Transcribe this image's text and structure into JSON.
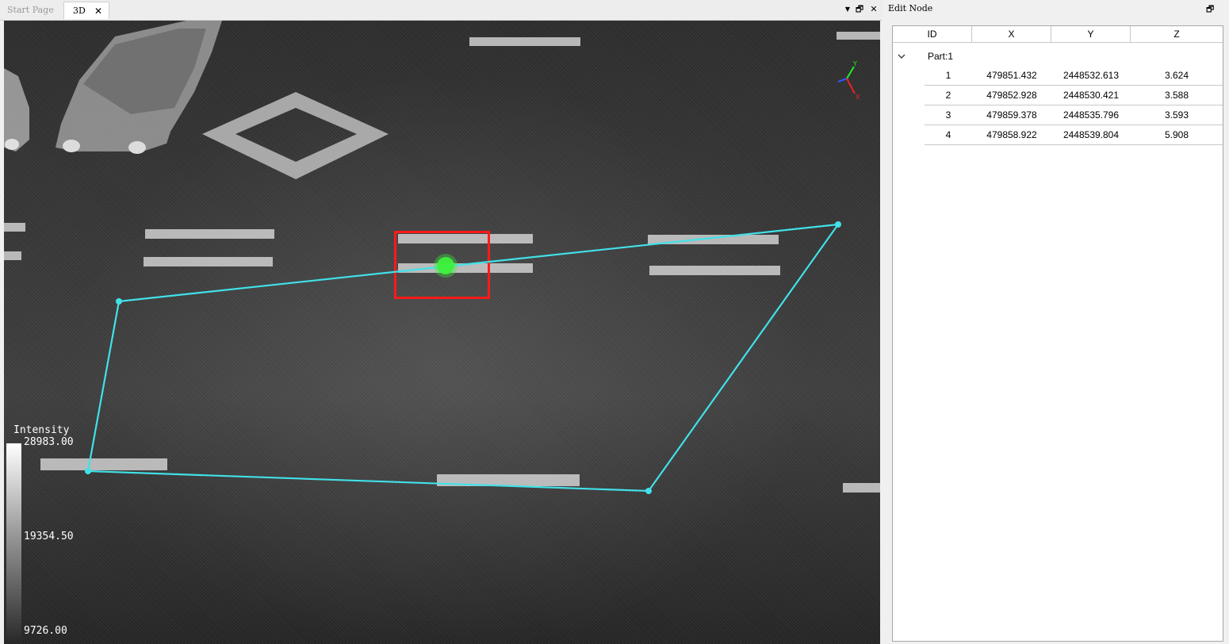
{
  "tabs": [
    {
      "label": "Start Page",
      "active": false
    },
    {
      "label": "3D",
      "active": true
    }
  ],
  "tab_close_glyph": "✕",
  "window_controls": {
    "menu_icon": "▼",
    "restore_icon": "🗗",
    "close_icon": "✕"
  },
  "viewport": {
    "legend": {
      "title": "Intensity",
      "max": "28983.00",
      "mid": "19354.50",
      "min": "9726.00"
    },
    "colors": {
      "polygon": "#41e1e8",
      "selection_box": "#ff1a1a",
      "picked_point": "#3cf23c",
      "markings": "#d9d9d9"
    },
    "axis_labels": {
      "y": "Y",
      "x": "X"
    }
  },
  "edit_node": {
    "title": "Edit Node",
    "restore_icon": "🗗",
    "columns": [
      "ID",
      "X",
      "Y",
      "Z"
    ],
    "part_label": "Part:1",
    "expand_icon": "chevron-down-icon",
    "nodes": [
      {
        "id": "1",
        "x": "479851.432",
        "y": "2448532.613",
        "z": "3.624"
      },
      {
        "id": "2",
        "x": "479852.928",
        "y": "2448530.421",
        "z": "3.588"
      },
      {
        "id": "3",
        "x": "479859.378",
        "y": "2448535.796",
        "z": "3.593"
      },
      {
        "id": "4",
        "x": "479858.922",
        "y": "2448539.804",
        "z": "5.908"
      }
    ]
  }
}
